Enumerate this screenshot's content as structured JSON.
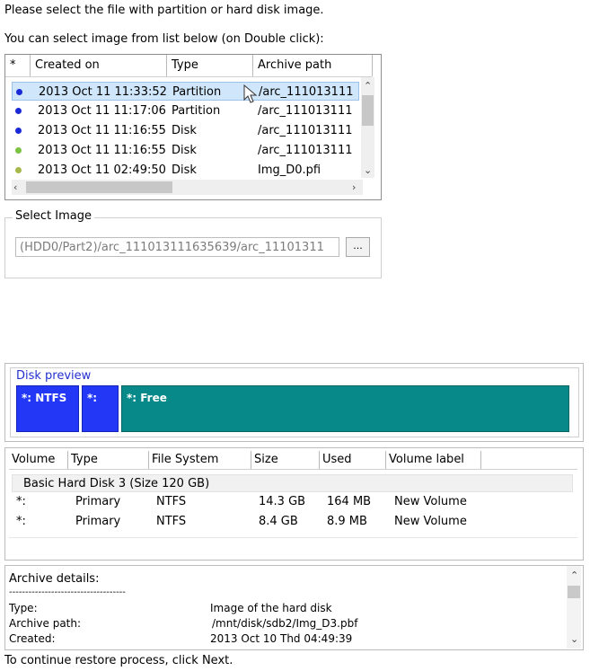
{
  "intro": {
    "line1": "Please select the file with partition or hard disk image.",
    "line2": "You can select image from list below (on Double click):"
  },
  "image_list": {
    "columns": [
      "*",
      "Created on",
      "Type",
      "Archive path"
    ],
    "rows": [
      {
        "created": "2013 Oct 11 11:33:52",
        "type": "Partition",
        "path": "/arc_111013111",
        "dot": "#1a2ad6",
        "selected": true
      },
      {
        "created": "2013 Oct 11 11:17:06",
        "type": "Partition",
        "path": "/arc_111013111",
        "dot": "#1a2ad6",
        "selected": false
      },
      {
        "created": "2013 Oct 11 11:16:55",
        "type": "Disk",
        "path": "/arc_111013111",
        "dot": "#1a2ad6",
        "selected": false
      },
      {
        "created": "2013 Oct 11 11:16:55",
        "type": "Disk",
        "path": "/arc_111013111",
        "dot": "#7cc242",
        "selected": false
      },
      {
        "created": "2013 Oct 11 02:49:50",
        "type": "Disk",
        "path": "Img_D0.pfi",
        "dot": "#a6b84a",
        "selected": false
      }
    ]
  },
  "select_image": {
    "label": "Select Image",
    "path_value": "(HDD0/Part2)/arc_111013111635639/arc_11101311",
    "browse_label": "..."
  },
  "disk_preview": {
    "title": "Disk preview",
    "partitions": [
      {
        "label": "*: NTFS",
        "color": "#2338f6"
      },
      {
        "label": "*:",
        "color": "#2338f6"
      },
      {
        "label": "*: Free",
        "color": "#07898a"
      }
    ]
  },
  "volumes": {
    "columns": [
      "Volume",
      "Type",
      "File System",
      "Size",
      "Used",
      "Volume label"
    ],
    "group_label": "Basic Hard Disk 3 (Size 120 GB)",
    "rows": [
      {
        "volume": "*:",
        "type": "Primary",
        "fs": "NTFS",
        "size": "14.3 GB",
        "used": "164 MB",
        "label": "New Volume"
      },
      {
        "volume": "*:",
        "type": "Primary",
        "fs": "NTFS",
        "size": "8.4 GB",
        "used": "8.9 MB",
        "label": "New Volume"
      }
    ]
  },
  "archive_details": {
    "title": "Archive details:",
    "separator": "------------------------------------",
    "fields": [
      {
        "key": "Type:",
        "value": "Image of the hard disk"
      },
      {
        "key": "Archive path:",
        "value": "/mnt/disk/sdb2/Img_D3.pbf"
      },
      {
        "key": "Created:",
        "value": "2013 Oct 10 Thd 04:49:39"
      }
    ]
  },
  "footer": {
    "text": "To continue restore process, click Next."
  }
}
